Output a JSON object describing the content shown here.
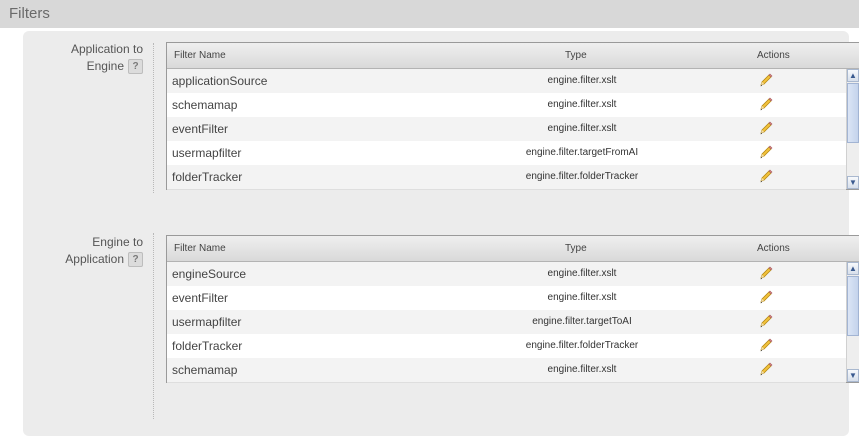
{
  "page": {
    "title": "Filters"
  },
  "help_symbol": "?",
  "columns": {
    "name": "Filter Name",
    "type": "Type",
    "actions": "Actions"
  },
  "sections": [
    {
      "label_line1": "Application to",
      "label_line2": "Engine",
      "rows": [
        {
          "name": "applicationSource",
          "type": "engine.filter.xslt"
        },
        {
          "name": "schemamap",
          "type": "engine.filter.xslt"
        },
        {
          "name": "eventFilter",
          "type": "engine.filter.xslt"
        },
        {
          "name": "usermapfilter",
          "type": "engine.filter.targetFromAI"
        },
        {
          "name": "folderTracker",
          "type": "engine.filter.folderTracker"
        }
      ]
    },
    {
      "label_line1": "Engine to",
      "label_line2": "Application",
      "rows": [
        {
          "name": "engineSource",
          "type": "engine.filter.xslt"
        },
        {
          "name": "eventFilter",
          "type": "engine.filter.xslt"
        },
        {
          "name": "usermapfilter",
          "type": "engine.filter.targetToAI"
        },
        {
          "name": "folderTracker",
          "type": "engine.filter.folderTracker"
        },
        {
          "name": "schemamap",
          "type": "engine.filter.xslt"
        }
      ]
    }
  ],
  "icons": {
    "edit": "pencil-edit-icon",
    "help": "help-icon",
    "scroll_up": "chevron-up-icon",
    "scroll_down": "chevron-down-icon"
  },
  "colors": {
    "panel": "#ececec",
    "header": "#d8d8d8",
    "scroll_accent": "#3a5a8f"
  }
}
